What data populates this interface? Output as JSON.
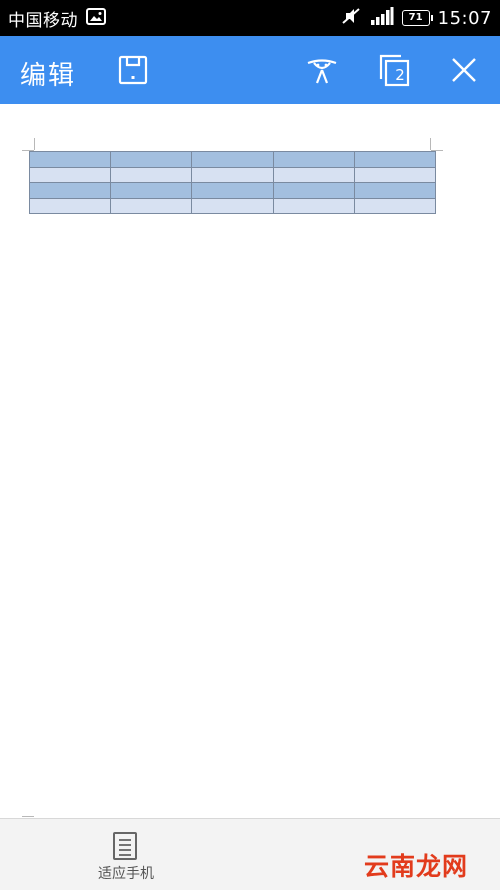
{
  "status_bar": {
    "carrier": "中国移动",
    "battery_level": "71",
    "time": "15:07"
  },
  "toolbar": {
    "edit_label": "编辑",
    "page_count": "2",
    "background_color": "#3d8ef0",
    "icons": [
      "save-icon",
      "ink-icon",
      "pages-icon",
      "close-icon"
    ]
  },
  "document": {
    "table": {
      "rows": 4,
      "columns": 5,
      "row_colors": [
        "#a3bfdf",
        "#d7e1f2",
        "#a3bfdf",
        "#d7e1f2"
      ]
    }
  },
  "bottom_bar": {
    "fit_phone_label": "适应手机",
    "watermark": "云南龙网"
  }
}
